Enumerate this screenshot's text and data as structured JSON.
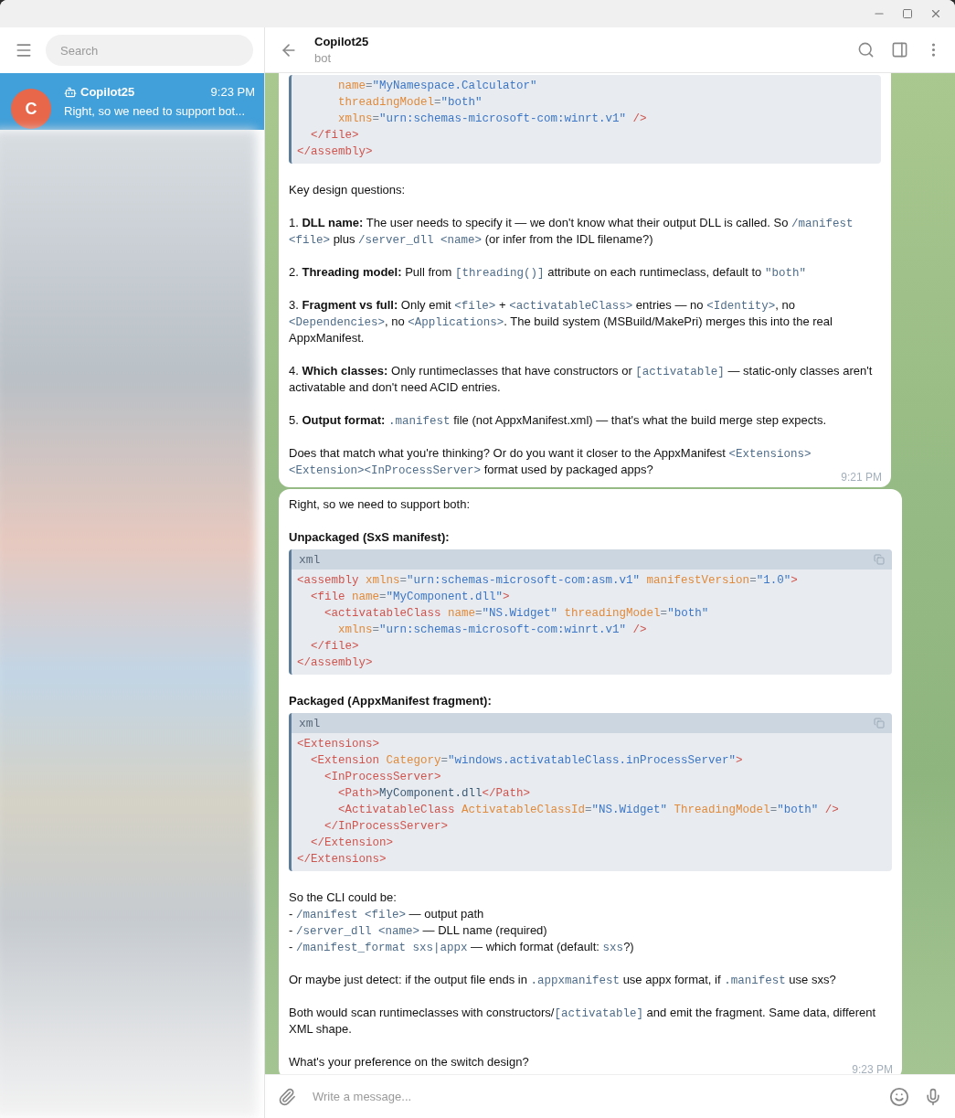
{
  "sidebar": {
    "search": {
      "placeholder": "Search"
    },
    "chats": [
      {
        "avatar_letter": "C",
        "name": "Copilot25",
        "time": "9:23 PM",
        "preview": "Right, so we need to support bot...",
        "selected": true
      }
    ]
  },
  "chat_header": {
    "title": "Copilot25",
    "subtitle": "bot"
  },
  "messages": [
    {
      "time": "9:21 PM",
      "blocks": [
        {
          "kind": "code",
          "lines": [
            [
              {
                "kind": "attr",
                "text": "      name"
              },
              {
                "kind": "eq",
                "text": "="
              },
              {
                "kind": "str",
                "text": "\"MyNamespace.Calculator\""
              }
            ],
            [
              {
                "kind": "attr",
                "text": "      threadingModel"
              },
              {
                "kind": "eq",
                "text": "="
              },
              {
                "kind": "str",
                "text": "\"both\""
              }
            ],
            [
              {
                "kind": "attr",
                "text": "      xmlns"
              },
              {
                "kind": "eq",
                "text": "="
              },
              {
                "kind": "str",
                "text": "\"urn:schemas-microsoft-com:winrt.v1\""
              },
              {
                "kind": "tag",
                "text": " />"
              }
            ],
            [
              {
                "kind": "tag",
                "text": "  </file>"
              }
            ],
            [
              {
                "kind": "tag",
                "text": "</assembly>"
              }
            ]
          ]
        },
        {
          "kind": "paragraph",
          "lines": [
            [
              {
                "kind": "text",
                "text": "Key design questions:"
              }
            ]
          ]
        },
        {
          "kind": "paragraph",
          "lines": [
            [
              {
                "kind": "text",
                "text": "1. "
              },
              {
                "kind": "bold",
                "text": "DLL name:"
              },
              {
                "kind": "text",
                "text": " The user needs to specify it — we don't know what their output DLL is called. So "
              },
              {
                "kind": "code",
                "text": "/manifest <file>"
              },
              {
                "kind": "text",
                "text": " plus "
              },
              {
                "kind": "code",
                "text": "/server_dll <name>"
              },
              {
                "kind": "text",
                "text": " (or infer from the IDL filename?)"
              }
            ]
          ]
        },
        {
          "kind": "paragraph",
          "lines": [
            [
              {
                "kind": "text",
                "text": "2. "
              },
              {
                "kind": "bold",
                "text": "Threading model:"
              },
              {
                "kind": "text",
                "text": " Pull from "
              },
              {
                "kind": "code",
                "text": "[threading()]"
              },
              {
                "kind": "text",
                "text": " attribute on each runtimeclass, default to "
              },
              {
                "kind": "code",
                "text": "\"both\""
              }
            ]
          ]
        },
        {
          "kind": "paragraph",
          "lines": [
            [
              {
                "kind": "text",
                "text": "3. "
              },
              {
                "kind": "bold",
                "text": "Fragment vs full:"
              },
              {
                "kind": "text",
                "text": " Only emit "
              },
              {
                "kind": "code",
                "text": "<file>"
              },
              {
                "kind": "text",
                "text": " + "
              },
              {
                "kind": "code",
                "text": "<activatableClass>"
              },
              {
                "kind": "text",
                "text": " entries — no "
              },
              {
                "kind": "code",
                "text": "<Identity>"
              },
              {
                "kind": "text",
                "text": ", no "
              },
              {
                "kind": "code",
                "text": "<Dependencies>"
              },
              {
                "kind": "text",
                "text": ", no "
              },
              {
                "kind": "code",
                "text": "<Applications>"
              },
              {
                "kind": "text",
                "text": ". The build system (MSBuild/MakePri) merges this into the real AppxManifest."
              }
            ]
          ]
        },
        {
          "kind": "paragraph",
          "lines": [
            [
              {
                "kind": "text",
                "text": "4. "
              },
              {
                "kind": "bold",
                "text": "Which classes:"
              },
              {
                "kind": "text",
                "text": " Only runtimeclasses that have constructors or "
              },
              {
                "kind": "code",
                "text": "[activatable]"
              },
              {
                "kind": "text",
                "text": " — static-only classes aren't activatable and don't need ACID entries."
              }
            ]
          ]
        },
        {
          "kind": "paragraph",
          "lines": [
            [
              {
                "kind": "text",
                "text": "5. "
              },
              {
                "kind": "bold",
                "text": "Output format: "
              },
              {
                "kind": "code",
                "text": ".manifest"
              },
              {
                "kind": "text",
                "text": " file (not AppxManifest.xml) — that's what the build merge step expects."
              }
            ]
          ]
        },
        {
          "kind": "paragraph",
          "lines": [
            [
              {
                "kind": "text",
                "text": "Does that match what you're thinking? Or do you want it closer to the AppxManifest "
              },
              {
                "kind": "code",
                "text": "<Extensions><Extension><InProcessServer>"
              },
              {
                "kind": "text",
                "text": " format used by packaged apps?"
              }
            ]
          ]
        }
      ]
    },
    {
      "time": "9:23 PM",
      "blocks": [
        {
          "kind": "paragraph",
          "lines": [
            [
              {
                "kind": "text",
                "text": "Right, so we need to support both:"
              }
            ]
          ]
        },
        {
          "kind": "paragraph",
          "lines": [
            [
              {
                "kind": "bold",
                "text": "Unpackaged (SxS manifest):"
              }
            ]
          ]
        },
        {
          "kind": "code",
          "language": "xml",
          "lines": [
            [
              {
                "kind": "tag",
                "text": "<assembly"
              },
              {
                "kind": "attr",
                "text": " xmlns"
              },
              {
                "kind": "eq",
                "text": "="
              },
              {
                "kind": "str",
                "text": "\"urn:schemas-microsoft-com:asm.v1\""
              },
              {
                "kind": "attr",
                "text": " manifestVersion"
              },
              {
                "kind": "eq",
                "text": "="
              },
              {
                "kind": "str",
                "text": "\"1.0\""
              },
              {
                "kind": "tag",
                "text": ">"
              }
            ],
            [
              {
                "kind": "tag",
                "text": "  <file"
              },
              {
                "kind": "attr",
                "text": " name"
              },
              {
                "kind": "eq",
                "text": "="
              },
              {
                "kind": "str",
                "text": "\"MyComponent.dll\""
              },
              {
                "kind": "tag",
                "text": ">"
              }
            ],
            [
              {
                "kind": "tag",
                "text": "    <activatableClass"
              },
              {
                "kind": "attr",
                "text": " name"
              },
              {
                "kind": "eq",
                "text": "="
              },
              {
                "kind": "str",
                "text": "\"NS.Widget\""
              },
              {
                "kind": "attr",
                "text": " threadingModel"
              },
              {
                "kind": "eq",
                "text": "="
              },
              {
                "kind": "str",
                "text": "\"both\""
              }
            ],
            [
              {
                "kind": "attr",
                "text": "      xmlns"
              },
              {
                "kind": "eq",
                "text": "="
              },
              {
                "kind": "str",
                "text": "\"urn:schemas-microsoft-com:winrt.v1\""
              },
              {
                "kind": "tag",
                "text": " />"
              }
            ],
            [
              {
                "kind": "tag",
                "text": "  </file>"
              }
            ],
            [
              {
                "kind": "tag",
                "text": "</assembly>"
              }
            ]
          ]
        },
        {
          "kind": "paragraph",
          "lines": [
            [
              {
                "kind": "bold",
                "text": "Packaged (AppxManifest fragment):"
              }
            ]
          ]
        },
        {
          "kind": "code",
          "language": "xml",
          "lines": [
            [
              {
                "kind": "tag",
                "text": "<Extensions>"
              }
            ],
            [
              {
                "kind": "tag",
                "text": "  <Extension"
              },
              {
                "kind": "attr",
                "text": " Category"
              },
              {
                "kind": "eq",
                "text": "="
              },
              {
                "kind": "str",
                "text": "\"windows.activatableClass.inProcessServer\""
              },
              {
                "kind": "tag",
                "text": ">"
              }
            ],
            [
              {
                "kind": "tag",
                "text": "    <InProcessServer>"
              }
            ],
            [
              {
                "kind": "tag",
                "text": "      <Path>"
              },
              {
                "kind": "txt",
                "text": "MyComponent.dll"
              },
              {
                "kind": "tag",
                "text": "</Path>"
              }
            ],
            [
              {
                "kind": "tag",
                "text": "      <ActivatableClass"
              },
              {
                "kind": "attr",
                "text": " ActivatableClassId"
              },
              {
                "kind": "eq",
                "text": "="
              },
              {
                "kind": "str",
                "text": "\"NS.Widget\""
              },
              {
                "kind": "attr",
                "text": " ThreadingModel"
              },
              {
                "kind": "eq",
                "text": "="
              },
              {
                "kind": "str",
                "text": "\"both\""
              },
              {
                "kind": "tag",
                "text": " />"
              }
            ],
            [
              {
                "kind": "tag",
                "text": "    </InProcessServer>"
              }
            ],
            [
              {
                "kind": "tag",
                "text": "  </Extension>"
              }
            ],
            [
              {
                "kind": "tag",
                "text": "</Extensions>"
              }
            ]
          ]
        },
        {
          "kind": "paragraph",
          "lines": [
            [
              {
                "kind": "text",
                "text": "So the CLI could be:"
              }
            ],
            [
              {
                "kind": "text",
                "text": "- "
              },
              {
                "kind": "code",
                "text": "/manifest <file>"
              },
              {
                "kind": "text",
                "text": " — output path"
              }
            ],
            [
              {
                "kind": "text",
                "text": "- "
              },
              {
                "kind": "code",
                "text": "/server_dll <name>"
              },
              {
                "kind": "text",
                "text": " — DLL name (required)"
              }
            ],
            [
              {
                "kind": "text",
                "text": "- "
              },
              {
                "kind": "code",
                "text": "/manifest_format sxs|appx"
              },
              {
                "kind": "text",
                "text": " — which format (default: "
              },
              {
                "kind": "code",
                "text": "sxs"
              },
              {
                "kind": "text",
                "text": "?)"
              }
            ]
          ]
        },
        {
          "kind": "paragraph",
          "lines": [
            [
              {
                "kind": "text",
                "text": "Or maybe just detect: if the output file ends in "
              },
              {
                "kind": "code",
                "text": ".appxmanifest"
              },
              {
                "kind": "text",
                "text": " use appx format, if "
              },
              {
                "kind": "code",
                "text": ".manifest"
              },
              {
                "kind": "text",
                "text": " use sxs?"
              }
            ]
          ]
        },
        {
          "kind": "paragraph",
          "lines": [
            [
              {
                "kind": "text",
                "text": "Both would scan runtimeclasses with constructors/"
              },
              {
                "kind": "code",
                "text": "[activatable]"
              },
              {
                "kind": "text",
                "text": " and emit the fragment. Same data, different XML shape."
              }
            ]
          ]
        },
        {
          "kind": "paragraph",
          "lines": [
            [
              {
                "kind": "text",
                "text": "What's your preference on the switch design?"
              }
            ]
          ]
        }
      ]
    }
  ],
  "composer": {
    "placeholder": "Write a message..."
  }
}
